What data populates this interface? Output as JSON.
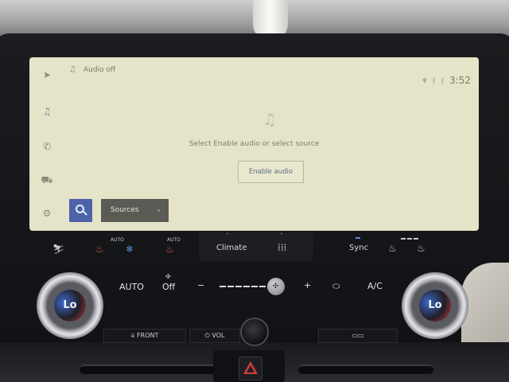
{
  "screen": {
    "header": {
      "audio_status": "Audio off",
      "time": "3:52"
    },
    "message": "Select Enable audio or select source",
    "enable_audio_label": "Enable audio",
    "sources_label": "Sources",
    "side_nav": [
      {
        "icon": "navigation-arrow-icon"
      },
      {
        "icon": "music-note-icon",
        "active": true
      },
      {
        "icon": "phone-icon"
      },
      {
        "icon": "car-icon"
      },
      {
        "icon": "settings-gear-icon"
      }
    ],
    "status_icons": [
      "microphone-icon",
      "bluetooth-icon",
      "bluetooth-icon"
    ]
  },
  "climate_strip": {
    "auto_label": "AUTO",
    "climate_label": "Climate",
    "sync_label": "Sync"
  },
  "controls": {
    "auto_label": "AUTO",
    "off_label": "Off",
    "minus_label": "−",
    "plus_label": "+",
    "ac_label": "A/C",
    "fan_level": 0.86
  },
  "temperature": {
    "left": "Lo",
    "right": "Lo"
  },
  "bottom_bar": {
    "front_label": "FRONT",
    "vol_label": "VOL"
  }
}
